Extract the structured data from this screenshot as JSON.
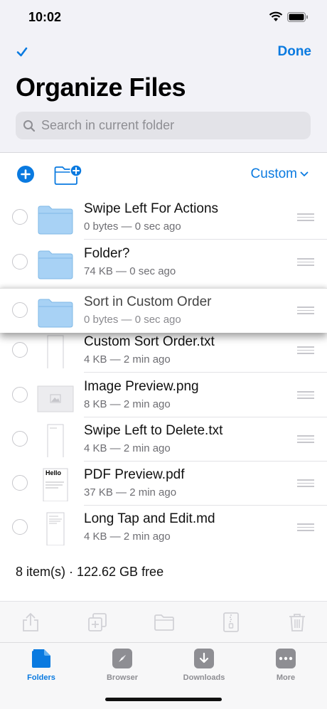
{
  "status_bar": {
    "time": "10:02"
  },
  "header": {
    "done_label": "Done",
    "title": "Organize Files",
    "search_placeholder": "Search in current folder"
  },
  "toolbar": {
    "sort_label": "Custom"
  },
  "files": [
    {
      "name": "Swipe Left For Actions",
      "meta": "0 bytes — 0 sec ago",
      "kind": "folder"
    },
    {
      "name": "Folder?",
      "meta": "74 KB — 0 sec ago",
      "kind": "folder"
    },
    {
      "name": "Sort in Custom Order",
      "meta": "0 bytes — 0 sec ago",
      "kind": "folder",
      "dragging": true
    },
    {
      "name": "Custom Sort Order.txt",
      "meta": "4 KB — 2 min ago",
      "kind": "txt"
    },
    {
      "name": "Image Preview.png",
      "meta": "8 KB — 2 min ago",
      "kind": "png"
    },
    {
      "name": "Swipe Left to Delete.txt",
      "meta": "4 KB — 2 min ago",
      "kind": "txt"
    },
    {
      "name": "PDF Preview.pdf",
      "meta": "37 KB — 2 min ago",
      "kind": "pdf",
      "preview_text": "Hello"
    },
    {
      "name": "Long Tap and Edit.md",
      "meta": "4 KB — 2 min ago",
      "kind": "md"
    }
  ],
  "summary": "8 item(s) · 122.62 GB free",
  "tabs": [
    {
      "label": "Folders",
      "icon": "folder-icon",
      "active": true
    },
    {
      "label": "Browser",
      "icon": "compass-icon",
      "active": false
    },
    {
      "label": "Downloads",
      "icon": "download-icon",
      "active": false
    },
    {
      "label": "More",
      "icon": "more-icon",
      "active": false
    }
  ],
  "colors": {
    "accent": "#0a7ae0",
    "inactive": "#8e8e93",
    "folder": "#a8d2f5"
  }
}
